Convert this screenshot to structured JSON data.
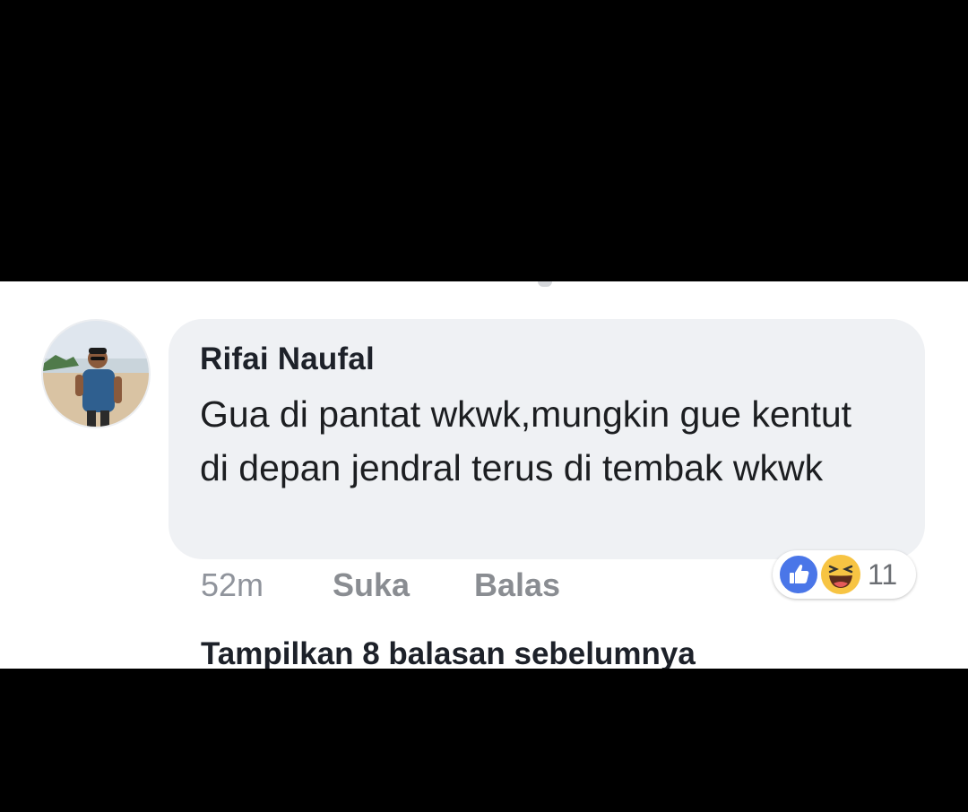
{
  "comment": {
    "author": "Rifai Naufal",
    "text": "Gua di pantat wkwk,mungkin gue kentut di depan jendral terus di tembak wkwk",
    "timestamp": "52m",
    "like_label": "Suka",
    "reply_label": "Balas"
  },
  "reactions": {
    "types": [
      "like-icon",
      "haha-icon"
    ],
    "count": "11",
    "like_color": "#4a76e8",
    "haha_color": "#f7c443"
  },
  "replies": {
    "show_previous_label": "Tampilkan 8 balasan sebelumnya"
  }
}
